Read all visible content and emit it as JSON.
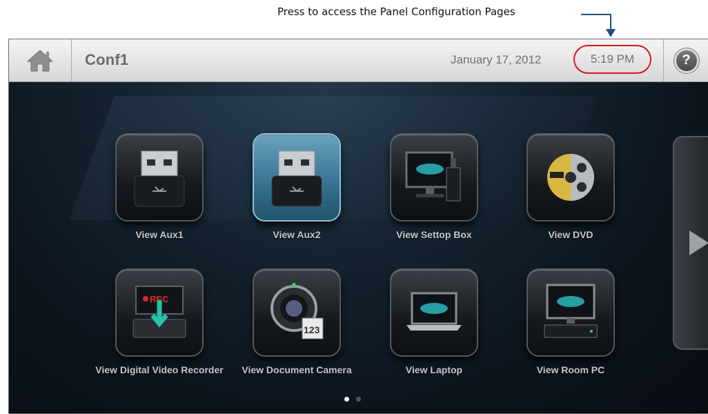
{
  "annotation": {
    "text": "Press to access the Panel Configuration Pages"
  },
  "header": {
    "room_name": "Conf1",
    "date": "January 17, 2012",
    "time": "5:19 PM",
    "help_label": "?"
  },
  "tiles": [
    {
      "label": "View Aux1",
      "icon": "usb-icon"
    },
    {
      "label": "View Aux2",
      "icon": "usb-icon",
      "active": true
    },
    {
      "label": "View Settop Box",
      "icon": "settop-box-icon"
    },
    {
      "label": "View DVD",
      "icon": "dvd-icon"
    },
    {
      "label": "View Digital Video Recorder",
      "icon": "dvr-icon",
      "overlay": "REC"
    },
    {
      "label": "View Document Camera",
      "icon": "document-camera-icon",
      "overlay": "123"
    },
    {
      "label": "View Laptop",
      "icon": "laptop-icon"
    },
    {
      "label": "View Room PC",
      "icon": "room-pc-icon"
    }
  ],
  "pagination": {
    "pages": 2,
    "current": 1
  },
  "colors": {
    "highlight": "#d8141b",
    "active_tile": "#3b7a9c",
    "callout": "#1f4f7a"
  }
}
